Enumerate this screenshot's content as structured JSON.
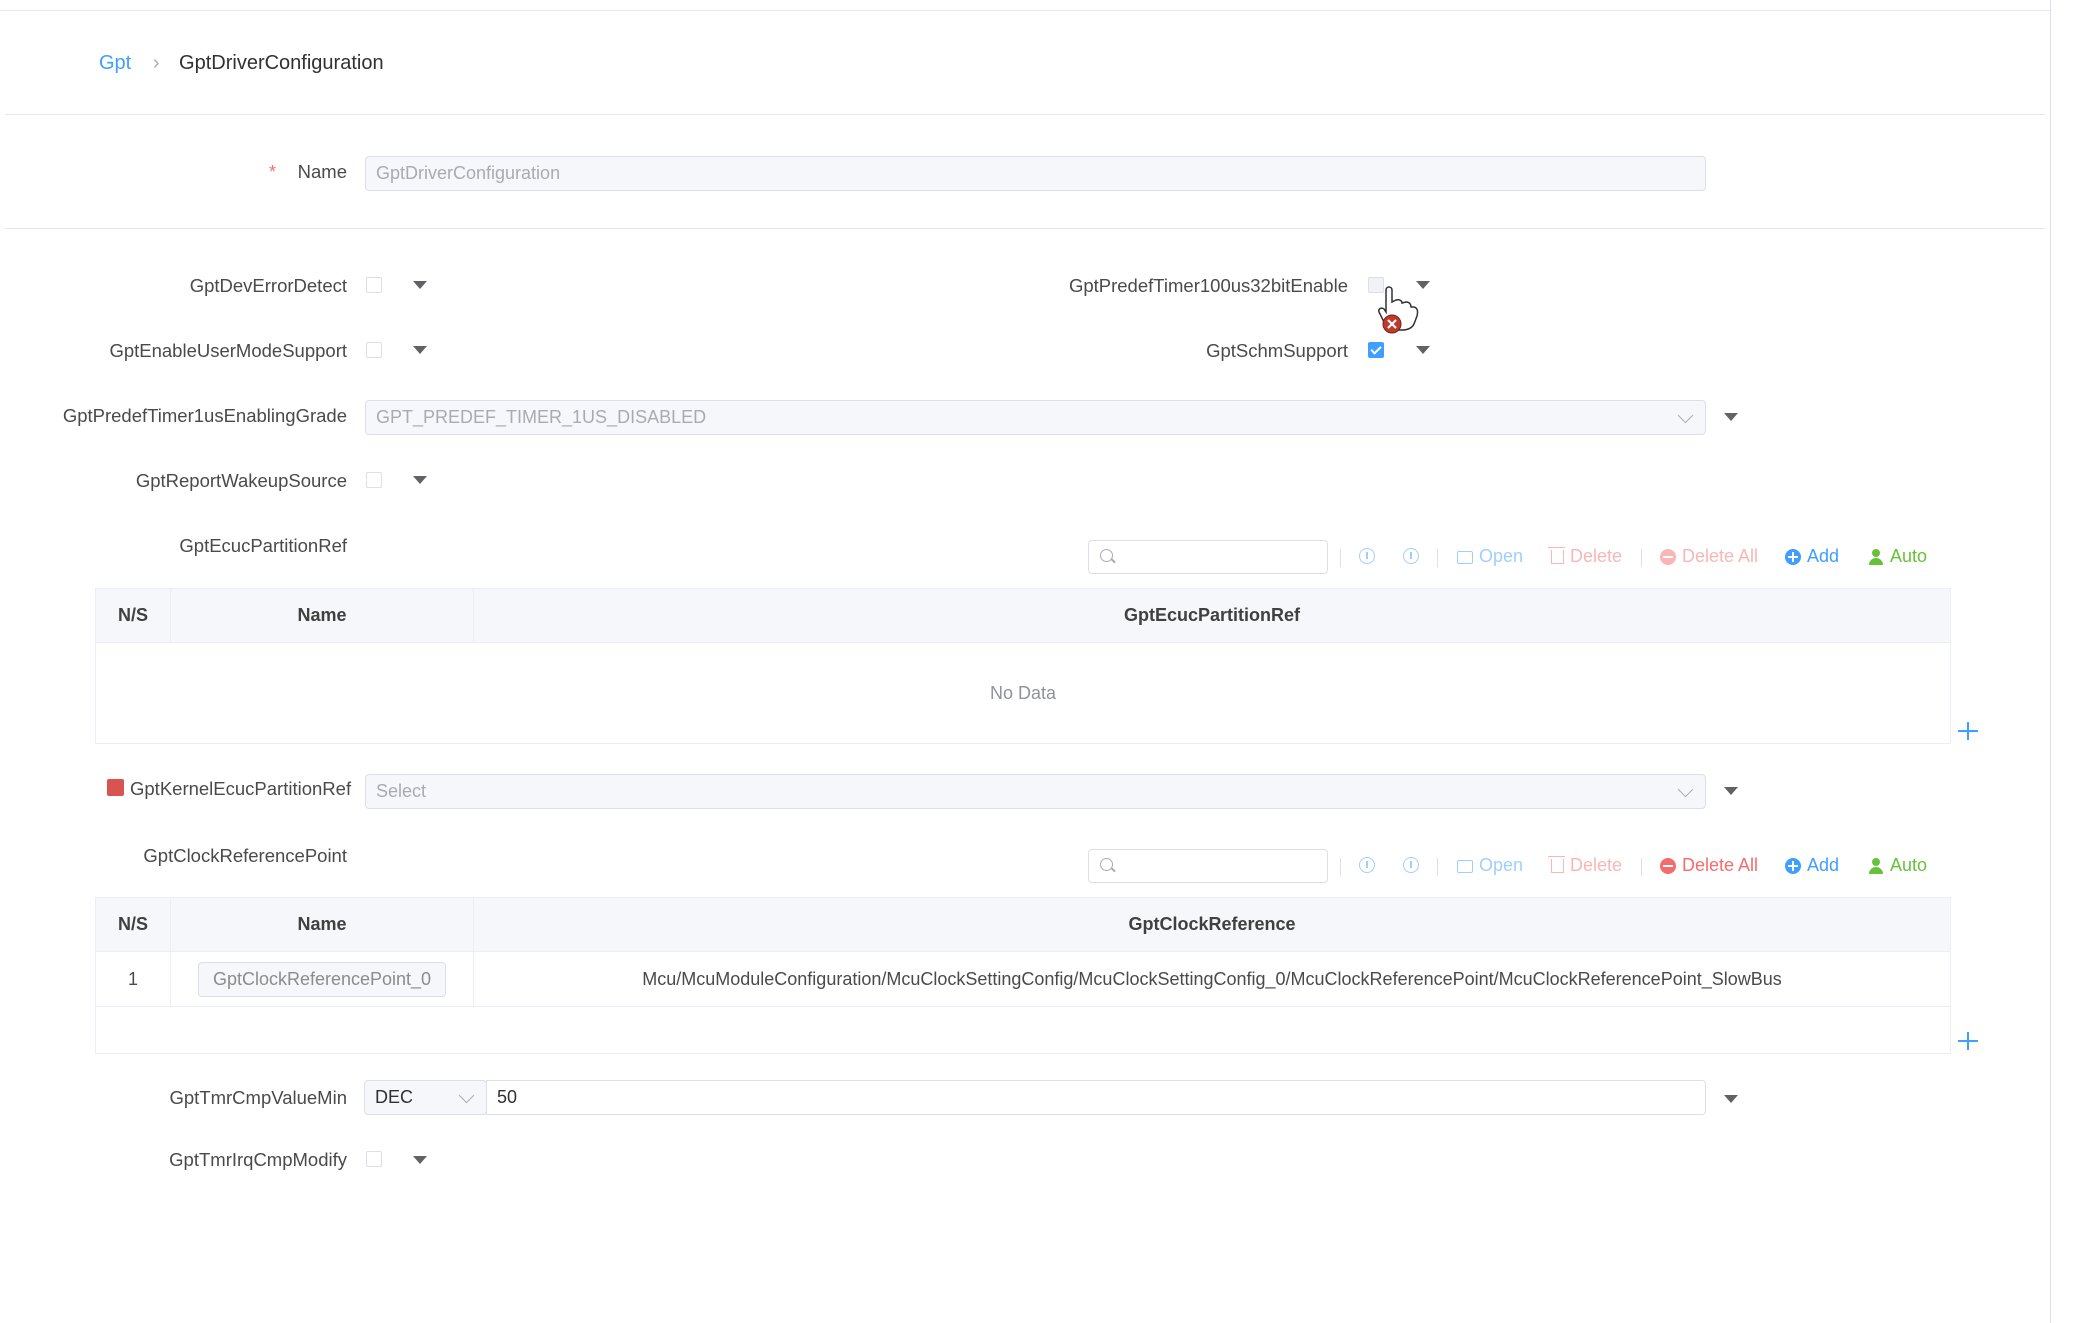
{
  "breadcrumb": {
    "root": "Gpt",
    "current": "GptDriverConfiguration"
  },
  "name_field": {
    "label": "Name",
    "required_mark": "*",
    "value": "GptDriverConfiguration"
  },
  "fields": {
    "dev_error_detect": {
      "label": "GptDevErrorDetect",
      "checked": false
    },
    "predef_timer_100us": {
      "label": "GptPredefTimer100us32bitEnable",
      "checked": false
    },
    "enable_user_mode": {
      "label": "GptEnableUserModeSupport",
      "checked": false
    },
    "schm_support": {
      "label": "GptSchmSupport",
      "checked": true
    },
    "predef_timer_1us": {
      "label": "GptPredefTimer1usEnablingGrade",
      "value": "GPT_PREDEF_TIMER_1US_DISABLED"
    },
    "report_wakeup": {
      "label": "GptReportWakeupSource",
      "checked": false
    },
    "kernel_ecuc": {
      "label": "GptKernelEcucPartitionRef",
      "placeholder": "Select",
      "marker_color": "#d9534f"
    },
    "tmr_cmp_min": {
      "label": "GptTmrCmpValueMin",
      "format": "DEC",
      "value": "50"
    },
    "tmr_irq_cmp": {
      "label": "GptTmrIrqCmpModify",
      "checked": false
    }
  },
  "toolbar": {
    "open": "Open",
    "delete": "Delete",
    "delete_all": "Delete All",
    "add": "Add",
    "auto": "Auto"
  },
  "ecuc_table": {
    "label": "GptEcucPartitionRef",
    "columns": [
      "N/S",
      "Name",
      "GptEcucPartitionRef"
    ],
    "empty_text": "No Data"
  },
  "clock_table": {
    "label": "GptClockReferencePoint",
    "columns": [
      "N/S",
      "Name",
      "GptClockReference"
    ],
    "rows": [
      {
        "ns": "1",
        "name": "GptClockReferencePoint_0",
        "ref": "Mcu/McuModuleConfiguration/McuClockSettingConfig/McuClockSettingConfig_0/McuClockReferencePoint/McuClockReferencePoint_SlowBus"
      }
    ]
  },
  "colors": {
    "link": "#409eff",
    "danger": "#f56c6c",
    "danger_light": "#fab6b6",
    "link_light": "#a0cfff",
    "success": "#67c23a"
  }
}
